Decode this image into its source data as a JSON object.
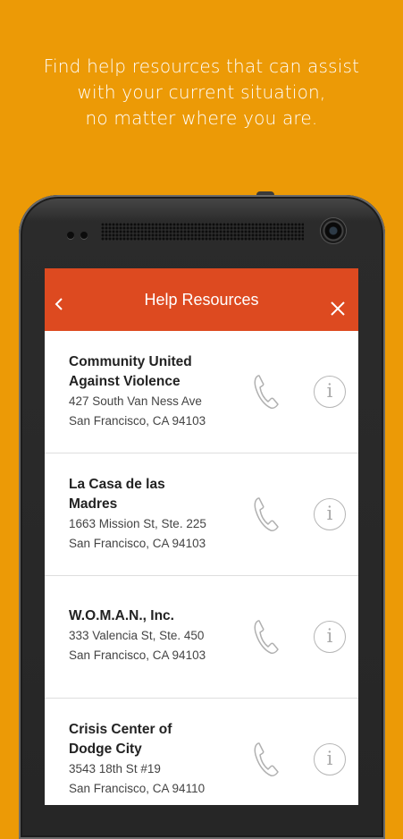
{
  "promo": {
    "lines": [
      "Find help resources that can assist",
      "with your current situation,",
      "no matter where you are."
    ]
  },
  "app_bar": {
    "title": "Help Resources",
    "back_icon": "chevron-left-icon",
    "close_icon": "close-icon",
    "color": "#DD4A20"
  },
  "resources": [
    {
      "name_lines": [
        "Community United",
        "Against Violence"
      ],
      "address": "427 South Van Ness Ave",
      "city": "San Francisco, CA 94103"
    },
    {
      "name_lines": [
        "La Casa de las",
        "Madres"
      ],
      "address": "1663 Mission St, Ste. 225",
      "city": "San Francisco, CA 94103"
    },
    {
      "name_lines": [
        "W.O.M.A.N., Inc."
      ],
      "address": "333 Valencia St, Ste. 450",
      "city": "San Francisco, CA 94103"
    },
    {
      "name_lines": [
        "Crisis Center of",
        "Dodge City"
      ],
      "address": "3543 18th St #19",
      "city": "San Francisco, CA 94110"
    }
  ],
  "icons": {
    "call": "phone-icon",
    "info": "info-icon",
    "info_glyph": "i"
  },
  "colors": {
    "background": "#EC9A06",
    "divider": "#dedede"
  }
}
